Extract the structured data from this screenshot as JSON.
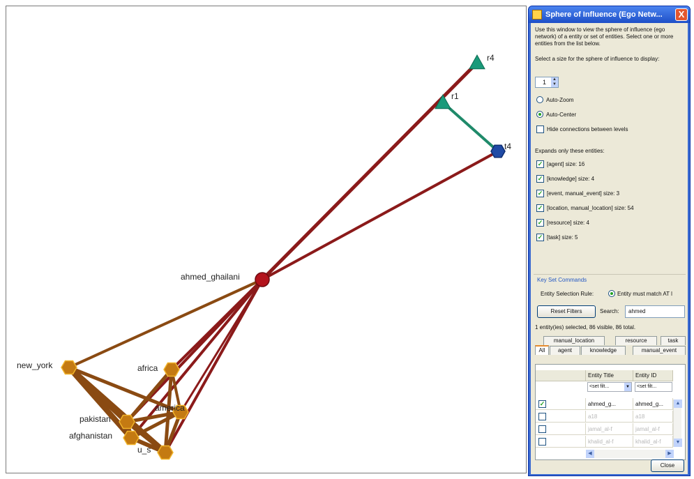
{
  "graph": {
    "nodes": [
      {
        "id": "ahmed_ghailani",
        "label": "ahmed_ghailani",
        "shape": "circle",
        "color": "#b3131c"
      },
      {
        "id": "r4",
        "label": "r4",
        "shape": "triangle",
        "color": "#1a9a7a"
      },
      {
        "id": "r1",
        "label": "r1",
        "shape": "triangle",
        "color": "#1a9a7a"
      },
      {
        "id": "t4",
        "label": "t4",
        "shape": "hexagon",
        "color": "#1f4aa5"
      },
      {
        "id": "new_york",
        "label": "new_york",
        "shape": "hexagon",
        "color": "#c47a12"
      },
      {
        "id": "africa",
        "label": "africa",
        "shape": "hexagon",
        "color": "#c47a12"
      },
      {
        "id": "pakistan",
        "label": "pakistan",
        "shape": "hexagon",
        "color": "#c47a12"
      },
      {
        "id": "afghanistan",
        "label": "afghanistan",
        "shape": "hexagon",
        "color": "#c47a12"
      },
      {
        "id": "america",
        "label": "america",
        "shape": "hexagon",
        "color": "#c47a12"
      },
      {
        "id": "u_s",
        "label": "u_s",
        "shape": "hexagon",
        "color": "#c47a12"
      }
    ],
    "edge_colors": {
      "agent": "#8b1a1a",
      "task": "#1f8a6a",
      "location": "#8a4a12"
    }
  },
  "panel": {
    "title": "Sphere of Influence (Ego Netw...",
    "close_label": "X",
    "description": "Use this window to view the sphere of influence (ego network) of a entity or set of entities. Select one or more entities from the list below.",
    "size_prompt": "Select a size for the sphere of influence to display:",
    "size_value": "1",
    "auto_zoom_label": "Auto-Zoom",
    "auto_center_label": "Auto-Center",
    "hide_connections_label": "Hide connections between levels",
    "expands_label": "Expands only these entities:",
    "entity_filters": [
      {
        "label": "[agent] size: 16",
        "checked": true
      },
      {
        "label": "[knowledge] size: 4",
        "checked": true
      },
      {
        "label": "[event, manual_event] size: 3",
        "checked": true
      },
      {
        "label": "[location, manual_location] size: 54",
        "checked": true
      },
      {
        "label": "[resource] size: 4",
        "checked": true
      },
      {
        "label": "[task] size: 5",
        "checked": true
      }
    ],
    "key_set_commands": "Key Set Commands",
    "selection_rule_label": "Entity Selection Rule:",
    "selection_rule_value": "Entity must match AT l",
    "reset_filters_label": "Reset Filters",
    "search_label": "Search:",
    "search_value": "ahmed",
    "status": "1 entity(ies) selected, 86 visible, 86 total.",
    "tabs_row1": [
      "manual_location",
      "resource",
      "task"
    ],
    "tabs_row2": [
      "All",
      "agent",
      "knowledge",
      "manual_event"
    ],
    "table": {
      "columns": [
        "Entity Title",
        "Entity ID"
      ],
      "filters": [
        "<set filt...",
        "<set filt..."
      ],
      "rows": [
        {
          "checked": true,
          "title": "ahmed_g...",
          "id": "ahmed_g..."
        },
        {
          "checked": false,
          "title": "a18",
          "id": "a18"
        },
        {
          "checked": false,
          "title": "jamal_al-f",
          "id": "jamal_al-f"
        },
        {
          "checked": false,
          "title": "khalid_al-f",
          "id": "khalid_al-f"
        }
      ]
    },
    "close_button": "Close"
  }
}
